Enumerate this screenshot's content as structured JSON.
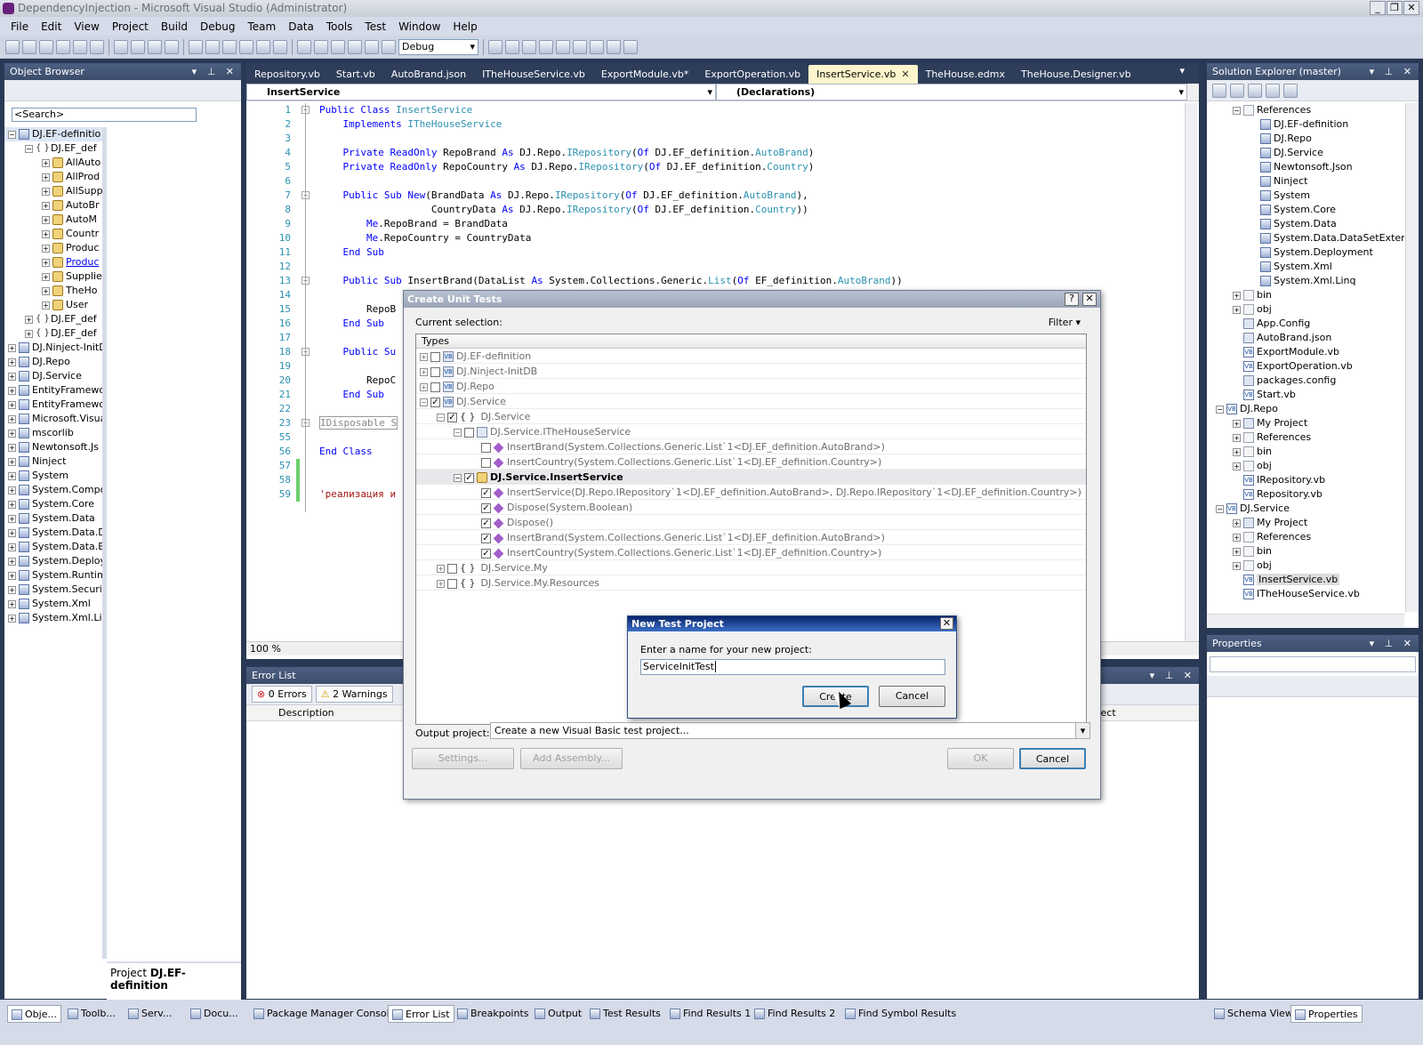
{
  "window": {
    "title": "DependencyInjection - Microsoft Visual Studio (Administrator)",
    "buttons": [
      "_",
      "❐",
      "✕"
    ]
  },
  "menu": [
    "File",
    "Edit",
    "View",
    "Project",
    "Build",
    "Debug",
    "Team",
    "Data",
    "Tools",
    "Test",
    "Window",
    "Help"
  ],
  "toolbar": {
    "config": "Debug"
  },
  "object_browser": {
    "title": "Object Browser",
    "search_placeholder": "<Search>",
    "tree": [
      {
        "d": 0,
        "pm": "−",
        "icon": "asm",
        "label": "DJ.EF-definitio",
        "sel": true
      },
      {
        "d": 1,
        "pm": "−",
        "icon": "ns",
        "label": "DJ.EF_def"
      },
      {
        "d": 2,
        "pm": "+",
        "icon": "cls",
        "label": "AllAuto"
      },
      {
        "d": 2,
        "pm": "+",
        "icon": "cls",
        "label": "AllProd"
      },
      {
        "d": 2,
        "pm": "+",
        "icon": "cls",
        "label": "AllSupp"
      },
      {
        "d": 2,
        "pm": "+",
        "icon": "cls",
        "label": "AutoBr"
      },
      {
        "d": 2,
        "pm": "+",
        "icon": "cls",
        "label": "AutoM"
      },
      {
        "d": 2,
        "pm": "+",
        "icon": "cls",
        "label": "Countr"
      },
      {
        "d": 2,
        "pm": "+",
        "icon": "cls",
        "label": "Produc"
      },
      {
        "d": 2,
        "pm": "+",
        "icon": "cls",
        "label": "Produc",
        "link": true
      },
      {
        "d": 2,
        "pm": "+",
        "icon": "cls",
        "label": "Supplie"
      },
      {
        "d": 2,
        "pm": "+",
        "icon": "cls",
        "label": "TheHo"
      },
      {
        "d": 2,
        "pm": "+",
        "icon": "cls",
        "label": "User"
      },
      {
        "d": 1,
        "pm": "+",
        "icon": "ns",
        "label": "DJ.EF_def"
      },
      {
        "d": 1,
        "pm": "+",
        "icon": "ns",
        "label": "DJ.EF_def"
      },
      {
        "d": 0,
        "pm": "+",
        "icon": "asm",
        "label": "DJ.Ninject-InitD"
      },
      {
        "d": 0,
        "pm": "+",
        "icon": "asm",
        "label": "DJ.Repo"
      },
      {
        "d": 0,
        "pm": "+",
        "icon": "asm",
        "label": "DJ.Service"
      },
      {
        "d": 0,
        "pm": "+",
        "icon": "asm",
        "label": "EntityFramework"
      },
      {
        "d": 0,
        "pm": "+",
        "icon": "asm",
        "label": "EntityFramewo"
      },
      {
        "d": 0,
        "pm": "+",
        "icon": "asm",
        "label": "Microsoft.Visua"
      },
      {
        "d": 0,
        "pm": "+",
        "icon": "asm",
        "label": "mscorlib"
      },
      {
        "d": 0,
        "pm": "+",
        "icon": "asm",
        "label": "Newtonsoft.Js"
      },
      {
        "d": 0,
        "pm": "+",
        "icon": "asm",
        "label": "Ninject"
      },
      {
        "d": 0,
        "pm": "+",
        "icon": "asm",
        "label": "System"
      },
      {
        "d": 0,
        "pm": "+",
        "icon": "asm",
        "label": "System.Compo"
      },
      {
        "d": 0,
        "pm": "+",
        "icon": "asm",
        "label": "System.Core"
      },
      {
        "d": 0,
        "pm": "+",
        "icon": "asm",
        "label": "System.Data"
      },
      {
        "d": 0,
        "pm": "+",
        "icon": "asm",
        "label": "System.Data.D"
      },
      {
        "d": 0,
        "pm": "+",
        "icon": "asm",
        "label": "System.Data.E"
      },
      {
        "d": 0,
        "pm": "+",
        "icon": "asm",
        "label": "System.Deploy"
      },
      {
        "d": 0,
        "pm": "+",
        "icon": "asm",
        "label": "System.Runtim"
      },
      {
        "d": 0,
        "pm": "+",
        "icon": "asm",
        "label": "System.Securi"
      },
      {
        "d": 0,
        "pm": "+",
        "icon": "asm",
        "label": "System.Xml"
      },
      {
        "d": 0,
        "pm": "+",
        "icon": "asm",
        "label": "System.Xml.Li"
      }
    ],
    "desc_prefix": "Project ",
    "desc_name": "DJ.EF-definition"
  },
  "editor": {
    "tabs": [
      {
        "label": "Repository.vb"
      },
      {
        "label": "Start.vb"
      },
      {
        "label": "AutoBrand.json"
      },
      {
        "label": "ITheHouseService.vb"
      },
      {
        "label": "ExportModule.vb*"
      },
      {
        "label": "ExportOperation.vb"
      },
      {
        "label": "InsertService.vb",
        "active": true
      },
      {
        "label": "TheHouse.edmx"
      },
      {
        "label": "TheHouse.Designer.vb"
      }
    ],
    "nav_left": "InsertService",
    "nav_right": "(Declarations)",
    "zoom": "100 %",
    "lines": [
      {
        "n": "1",
        "html": "<span class='kw'>Public Class</span> <span class='ty'>InsertService</span>"
      },
      {
        "n": "2",
        "html": "    <span class='kw'>Implements</span> <span class='ty'>ITheHouseService</span>"
      },
      {
        "n": "3",
        "html": ""
      },
      {
        "n": "4",
        "html": "    <span class='kw'>Private ReadOnly</span> RepoBrand <span class='kw'>As</span> DJ.Repo.<span class='ty'>IRepository</span>(<span class='kw'>Of</span> DJ.EF_definition.<span class='ty'>AutoBrand</span>)"
      },
      {
        "n": "5",
        "html": "    <span class='kw'>Private ReadOnly</span> RepoCountry <span class='kw'>As</span> DJ.Repo.<span class='ty'>IRepository</span>(<span class='kw'>Of</span> DJ.EF_definition.<span class='ty'>Country</span>)"
      },
      {
        "n": "6",
        "html": ""
      },
      {
        "n": "7",
        "html": "    <span class='kw'>Public Sub New</span>(BrandData <span class='kw'>As</span> DJ.Repo.<span class='ty'>IRepository</span>(<span class='kw'>Of</span> DJ.EF_definition.<span class='ty'>AutoBrand</span>),"
      },
      {
        "n": "8",
        "html": "                   CountryData <span class='kw'>As</span> DJ.Repo.<span class='ty'>IRepository</span>(<span class='kw'>Of</span> DJ.EF_definition.<span class='ty'>Country</span>))"
      },
      {
        "n": "9",
        "html": "        <span class='kw'>Me</span>.RepoBrand = BrandData"
      },
      {
        "n": "10",
        "html": "        <span class='kw'>Me</span>.RepoCountry = CountryData"
      },
      {
        "n": "11",
        "html": "    <span class='kw'>End Sub</span>"
      },
      {
        "n": "12",
        "html": ""
      },
      {
        "n": "13",
        "html": "    <span class='kw'>Public Sub</span> InsertBrand(DataList <span class='kw'>As</span> System.Collections.Generic.<span class='ty'>List</span>(<span class='kw'>Of</span> EF_definition.<span class='ty'>AutoBrand</span>))"
      },
      {
        "n": "14",
        "html": ""
      },
      {
        "n": "15",
        "html": "        RepoB"
      },
      {
        "n": "16",
        "html": "    <span class='kw'>End Sub</span>"
      },
      {
        "n": "17",
        "html": ""
      },
      {
        "n": "18",
        "html": "    <span class='kw'>Public Su</span>"
      },
      {
        "n": "19",
        "html": ""
      },
      {
        "n": "20",
        "html": "        RepoC"
      },
      {
        "n": "21",
        "html": "    <span class='kw'>End Sub</span>"
      },
      {
        "n": "22",
        "html": ""
      },
      {
        "n": "23",
        "html": "<span style='border:1px solid #999;color:#888'>IDisposable S</span>"
      },
      {
        "n": "55",
        "html": ""
      },
      {
        "n": "56",
        "html": "<span class='kw'>End Class</span>"
      },
      {
        "n": "57",
        "html": ""
      },
      {
        "n": "58",
        "html": ""
      },
      {
        "n": "59",
        "html": "<span class='st'>'реализация и</span>"
      }
    ]
  },
  "error_list": {
    "title": "Error List",
    "errors": "0 Errors",
    "warnings": "2 Warnings",
    "col_description": "Description",
    "col_project": "Project"
  },
  "solution_explorer": {
    "title": "Solution Explorer (master)",
    "tree": [
      {
        "d": 1,
        "pm": "−",
        "icon": "fold",
        "label": "References"
      },
      {
        "d": 2,
        "icon": "asm",
        "label": "DJ.EF-definition"
      },
      {
        "d": 2,
        "icon": "asm",
        "label": "DJ.Repo"
      },
      {
        "d": 2,
        "icon": "asm",
        "label": "DJ.Service"
      },
      {
        "d": 2,
        "icon": "asm",
        "label": "Newtonsoft.Json"
      },
      {
        "d": 2,
        "icon": "asm",
        "label": "Ninject"
      },
      {
        "d": 2,
        "icon": "asm",
        "label": "System"
      },
      {
        "d": 2,
        "icon": "asm",
        "label": "System.Core"
      },
      {
        "d": 2,
        "icon": "asm",
        "label": "System.Data"
      },
      {
        "d": 2,
        "icon": "asm",
        "label": "System.Data.DataSetExten"
      },
      {
        "d": 2,
        "icon": "asm",
        "label": "System.Deployment"
      },
      {
        "d": 2,
        "icon": "asm",
        "label": "System.Xml"
      },
      {
        "d": 2,
        "icon": "asm",
        "label": "System.Xml.Linq"
      },
      {
        "d": 1,
        "pm": "+",
        "icon": "fold",
        "label": "bin"
      },
      {
        "d": 1,
        "pm": "+",
        "icon": "fold",
        "label": "obj"
      },
      {
        "d": 1,
        "icon": "cfg",
        "label": "App.Config"
      },
      {
        "d": 1,
        "icon": "cfg",
        "label": "AutoBrand.json"
      },
      {
        "d": 1,
        "icon": "vb",
        "label": "ExportModule.vb"
      },
      {
        "d": 1,
        "icon": "vb",
        "label": "ExportOperation.vb"
      },
      {
        "d": 1,
        "icon": "cfg",
        "label": "packages.config"
      },
      {
        "d": 1,
        "icon": "vb",
        "label": "Start.vb"
      },
      {
        "d": 0,
        "pm": "−",
        "icon": "vb",
        "label": "DJ.Repo"
      },
      {
        "d": 1,
        "pm": "+",
        "icon": "cfg",
        "label": "My Project"
      },
      {
        "d": 1,
        "pm": "+",
        "icon": "fold",
        "label": "References"
      },
      {
        "d": 1,
        "pm": "+",
        "icon": "fold",
        "label": "bin"
      },
      {
        "d": 1,
        "pm": "+",
        "icon": "fold",
        "label": "obj"
      },
      {
        "d": 1,
        "icon": "vb",
        "label": "IRepository.vb"
      },
      {
        "d": 1,
        "icon": "vb",
        "label": "Repository.vb"
      },
      {
        "d": 0,
        "pm": "−",
        "icon": "vb",
        "label": "DJ.Service"
      },
      {
        "d": 1,
        "pm": "+",
        "icon": "cfg",
        "label": "My Project"
      },
      {
        "d": 1,
        "pm": "+",
        "icon": "fold",
        "label": "References"
      },
      {
        "d": 1,
        "pm": "+",
        "icon": "fold",
        "label": "bin"
      },
      {
        "d": 1,
        "pm": "+",
        "icon": "fold",
        "label": "obj"
      },
      {
        "d": 1,
        "icon": "vb",
        "label": "InsertService.vb",
        "sel": true
      },
      {
        "d": 1,
        "icon": "vb",
        "label": "ITheHouseService.vb"
      }
    ]
  },
  "properties": {
    "title": "Properties"
  },
  "bottom_tabs_left": [
    "Obje...",
    "Toolb...",
    "Serv...",
    "Docu..."
  ],
  "bottom_tabs_mid": [
    "Package Manager Console",
    "Error List",
    "Breakpoints",
    "Output",
    "Test Results",
    "Find Results 1",
    "Find Results 2",
    "Find Symbol Results"
  ],
  "bottom_tabs_right": [
    "Schema View",
    "Properties"
  ],
  "create_unit_tests": {
    "title": "Create Unit Tests",
    "current_selection": "Current selection:",
    "filter": "Filter",
    "types_header": "Types",
    "rows": [
      {
        "d": 0,
        "pm": "+",
        "cb": "",
        "icon": "ii",
        "label": "DJ.EF-definition"
      },
      {
        "d": 0,
        "pm": "+",
        "cb": "",
        "icon": "ii",
        "label": "DJ.Ninject-InitDB"
      },
      {
        "d": 0,
        "pm": "+",
        "cb": "",
        "icon": "ii",
        "label": "DJ.Repo"
      },
      {
        "d": 0,
        "pm": "−",
        "cb": "✓",
        "dim": true,
        "icon": "ii",
        "label": "DJ.Service"
      },
      {
        "d": 1,
        "pm": "−",
        "cb": "✓",
        "dim": true,
        "icon": "ns",
        "label": "DJ.Service"
      },
      {
        "d": 2,
        "pm": "−",
        "cb": "",
        "icon": "iface",
        "label": "DJ.Service.ITheHouseService"
      },
      {
        "d": 3,
        "cb": "",
        "icon": "mi",
        "label": "InsertBrand(System.Collections.Generic.List`1<DJ.EF_definition.AutoBrand>)"
      },
      {
        "d": 3,
        "cb": "",
        "icon": "mi",
        "label": "InsertCountry(System.Collections.Generic.List`1<DJ.EF_definition.Country>)"
      },
      {
        "d": 2,
        "pm": "−",
        "cb": "✓",
        "icon": "cls",
        "label": "DJ.Service.InsertService",
        "sel": true
      },
      {
        "d": 3,
        "cb": "✓",
        "icon": "mi",
        "label": "InsertService(DJ.Repo.IRepository`1<DJ.EF_definition.AutoBrand>, DJ.Repo.IRepository`1<DJ.EF_definition.Country>)"
      },
      {
        "d": 3,
        "cb": "✓",
        "icon": "mi",
        "label": "Dispose(System.Boolean)"
      },
      {
        "d": 3,
        "cb": "✓",
        "icon": "mi",
        "label": "Dispose()"
      },
      {
        "d": 3,
        "cb": "✓",
        "icon": "mi",
        "label": "InsertBrand(System.Collections.Generic.List`1<DJ.EF_definition.AutoBrand>)"
      },
      {
        "d": 3,
        "cb": "✓",
        "icon": "mi",
        "label": "InsertCountry(System.Collections.Generic.List`1<DJ.EF_definition.Country>)"
      },
      {
        "d": 1,
        "pm": "+",
        "cb": "",
        "icon": "ns",
        "label": "DJ.Service.My"
      },
      {
        "d": 1,
        "pm": "+",
        "cb": "",
        "icon": "ns",
        "label": "DJ.Service.My.Resources"
      }
    ],
    "output_label": "Output project:",
    "output_value": "Create a new Visual Basic test project...",
    "settings": "Settings...",
    "add_assembly": "Add Assembly...",
    "ok": "OK",
    "cancel": "Cancel"
  },
  "new_test_project": {
    "title": "New Test Project",
    "prompt": "Enter a name for your new project:",
    "name_value": "ServiceInitTest",
    "create": "Create",
    "cancel": "Cancel"
  }
}
